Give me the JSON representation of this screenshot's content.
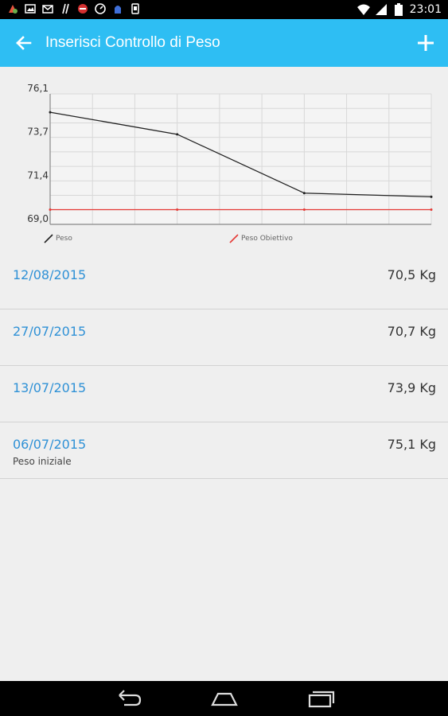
{
  "status_bar": {
    "time": "23:01",
    "icons": [
      "notification-icon",
      "photo-icon",
      "mail-icon",
      "tools-icon",
      "no-sign-icon",
      "speedometer-icon",
      "vpn-icon",
      "phone-icon",
      "wifi-icon",
      "signal-icon",
      "battery-icon"
    ]
  },
  "app_bar": {
    "title": "Inserisci Controllo di Peso",
    "back_icon": "arrow-back-icon",
    "add_icon": "plus-icon",
    "background": "#2ebef3"
  },
  "chart_data": {
    "type": "line",
    "y_ticks": [
      "76,1",
      "73,7",
      "71,4",
      "69,0"
    ],
    "ylim": [
      69.0,
      76.1
    ],
    "x_divisions": 9,
    "series": [
      {
        "name": "Peso",
        "color": "#222222",
        "x": [
          0,
          3,
          6,
          9
        ],
        "values": [
          75.1,
          73.9,
          70.7,
          70.5
        ]
      },
      {
        "name": "Peso Obiettivo",
        "color": "#e53935",
        "x": [
          0,
          3,
          6,
          9
        ],
        "values": [
          69.8,
          69.8,
          69.8,
          69.8
        ]
      }
    ],
    "grid": true,
    "legend_position": "bottom"
  },
  "entries": [
    {
      "date": "12/08/2015",
      "weight": "70,5 Kg",
      "note": ""
    },
    {
      "date": "27/07/2015",
      "weight": "70,7 Kg",
      "note": ""
    },
    {
      "date": "13/07/2015",
      "weight": "73,9 Kg",
      "note": ""
    },
    {
      "date": "06/07/2015",
      "weight": "75,1 Kg",
      "note": "Peso iniziale"
    }
  ],
  "nav_bar": {
    "buttons": [
      "back-nav-icon",
      "home-nav-icon",
      "recent-apps-icon"
    ]
  }
}
